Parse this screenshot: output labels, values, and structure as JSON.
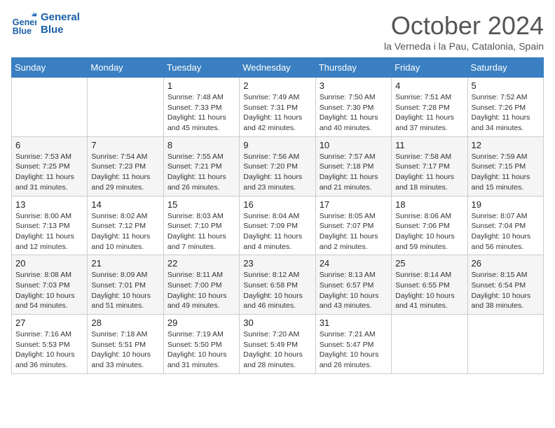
{
  "header": {
    "logo_general": "General",
    "logo_blue": "Blue",
    "month": "October 2024",
    "location": "la Verneda i la Pau, Catalonia, Spain"
  },
  "days": [
    "Sunday",
    "Monday",
    "Tuesday",
    "Wednesday",
    "Thursday",
    "Friday",
    "Saturday"
  ],
  "weeks": [
    [
      {
        "date": "",
        "info": ""
      },
      {
        "date": "",
        "info": ""
      },
      {
        "date": "1",
        "info": "Sunrise: 7:48 AM\nSunset: 7:33 PM\nDaylight: 11 hours and 45 minutes."
      },
      {
        "date": "2",
        "info": "Sunrise: 7:49 AM\nSunset: 7:31 PM\nDaylight: 11 hours and 42 minutes."
      },
      {
        "date": "3",
        "info": "Sunrise: 7:50 AM\nSunset: 7:30 PM\nDaylight: 11 hours and 40 minutes."
      },
      {
        "date": "4",
        "info": "Sunrise: 7:51 AM\nSunset: 7:28 PM\nDaylight: 11 hours and 37 minutes."
      },
      {
        "date": "5",
        "info": "Sunrise: 7:52 AM\nSunset: 7:26 PM\nDaylight: 11 hours and 34 minutes."
      }
    ],
    [
      {
        "date": "6",
        "info": "Sunrise: 7:53 AM\nSunset: 7:25 PM\nDaylight: 11 hours and 31 minutes."
      },
      {
        "date": "7",
        "info": "Sunrise: 7:54 AM\nSunset: 7:23 PM\nDaylight: 11 hours and 29 minutes."
      },
      {
        "date": "8",
        "info": "Sunrise: 7:55 AM\nSunset: 7:21 PM\nDaylight: 11 hours and 26 minutes."
      },
      {
        "date": "9",
        "info": "Sunrise: 7:56 AM\nSunset: 7:20 PM\nDaylight: 11 hours and 23 minutes."
      },
      {
        "date": "10",
        "info": "Sunrise: 7:57 AM\nSunset: 7:18 PM\nDaylight: 11 hours and 21 minutes."
      },
      {
        "date": "11",
        "info": "Sunrise: 7:58 AM\nSunset: 7:17 PM\nDaylight: 11 hours and 18 minutes."
      },
      {
        "date": "12",
        "info": "Sunrise: 7:59 AM\nSunset: 7:15 PM\nDaylight: 11 hours and 15 minutes."
      }
    ],
    [
      {
        "date": "13",
        "info": "Sunrise: 8:00 AM\nSunset: 7:13 PM\nDaylight: 11 hours and 12 minutes."
      },
      {
        "date": "14",
        "info": "Sunrise: 8:02 AM\nSunset: 7:12 PM\nDaylight: 11 hours and 10 minutes."
      },
      {
        "date": "15",
        "info": "Sunrise: 8:03 AM\nSunset: 7:10 PM\nDaylight: 11 hours and 7 minutes."
      },
      {
        "date": "16",
        "info": "Sunrise: 8:04 AM\nSunset: 7:09 PM\nDaylight: 11 hours and 4 minutes."
      },
      {
        "date": "17",
        "info": "Sunrise: 8:05 AM\nSunset: 7:07 PM\nDaylight: 11 hours and 2 minutes."
      },
      {
        "date": "18",
        "info": "Sunrise: 8:06 AM\nSunset: 7:06 PM\nDaylight: 10 hours and 59 minutes."
      },
      {
        "date": "19",
        "info": "Sunrise: 8:07 AM\nSunset: 7:04 PM\nDaylight: 10 hours and 56 minutes."
      }
    ],
    [
      {
        "date": "20",
        "info": "Sunrise: 8:08 AM\nSunset: 7:03 PM\nDaylight: 10 hours and 54 minutes."
      },
      {
        "date": "21",
        "info": "Sunrise: 8:09 AM\nSunset: 7:01 PM\nDaylight: 10 hours and 51 minutes."
      },
      {
        "date": "22",
        "info": "Sunrise: 8:11 AM\nSunset: 7:00 PM\nDaylight: 10 hours and 49 minutes."
      },
      {
        "date": "23",
        "info": "Sunrise: 8:12 AM\nSunset: 6:58 PM\nDaylight: 10 hours and 46 minutes."
      },
      {
        "date": "24",
        "info": "Sunrise: 8:13 AM\nSunset: 6:57 PM\nDaylight: 10 hours and 43 minutes."
      },
      {
        "date": "25",
        "info": "Sunrise: 8:14 AM\nSunset: 6:55 PM\nDaylight: 10 hours and 41 minutes."
      },
      {
        "date": "26",
        "info": "Sunrise: 8:15 AM\nSunset: 6:54 PM\nDaylight: 10 hours and 38 minutes."
      }
    ],
    [
      {
        "date": "27",
        "info": "Sunrise: 7:16 AM\nSunset: 5:53 PM\nDaylight: 10 hours and 36 minutes."
      },
      {
        "date": "28",
        "info": "Sunrise: 7:18 AM\nSunset: 5:51 PM\nDaylight: 10 hours and 33 minutes."
      },
      {
        "date": "29",
        "info": "Sunrise: 7:19 AM\nSunset: 5:50 PM\nDaylight: 10 hours and 31 minutes."
      },
      {
        "date": "30",
        "info": "Sunrise: 7:20 AM\nSunset: 5:49 PM\nDaylight: 10 hours and 28 minutes."
      },
      {
        "date": "31",
        "info": "Sunrise: 7:21 AM\nSunset: 5:47 PM\nDaylight: 10 hours and 26 minutes."
      },
      {
        "date": "",
        "info": ""
      },
      {
        "date": "",
        "info": ""
      }
    ]
  ]
}
